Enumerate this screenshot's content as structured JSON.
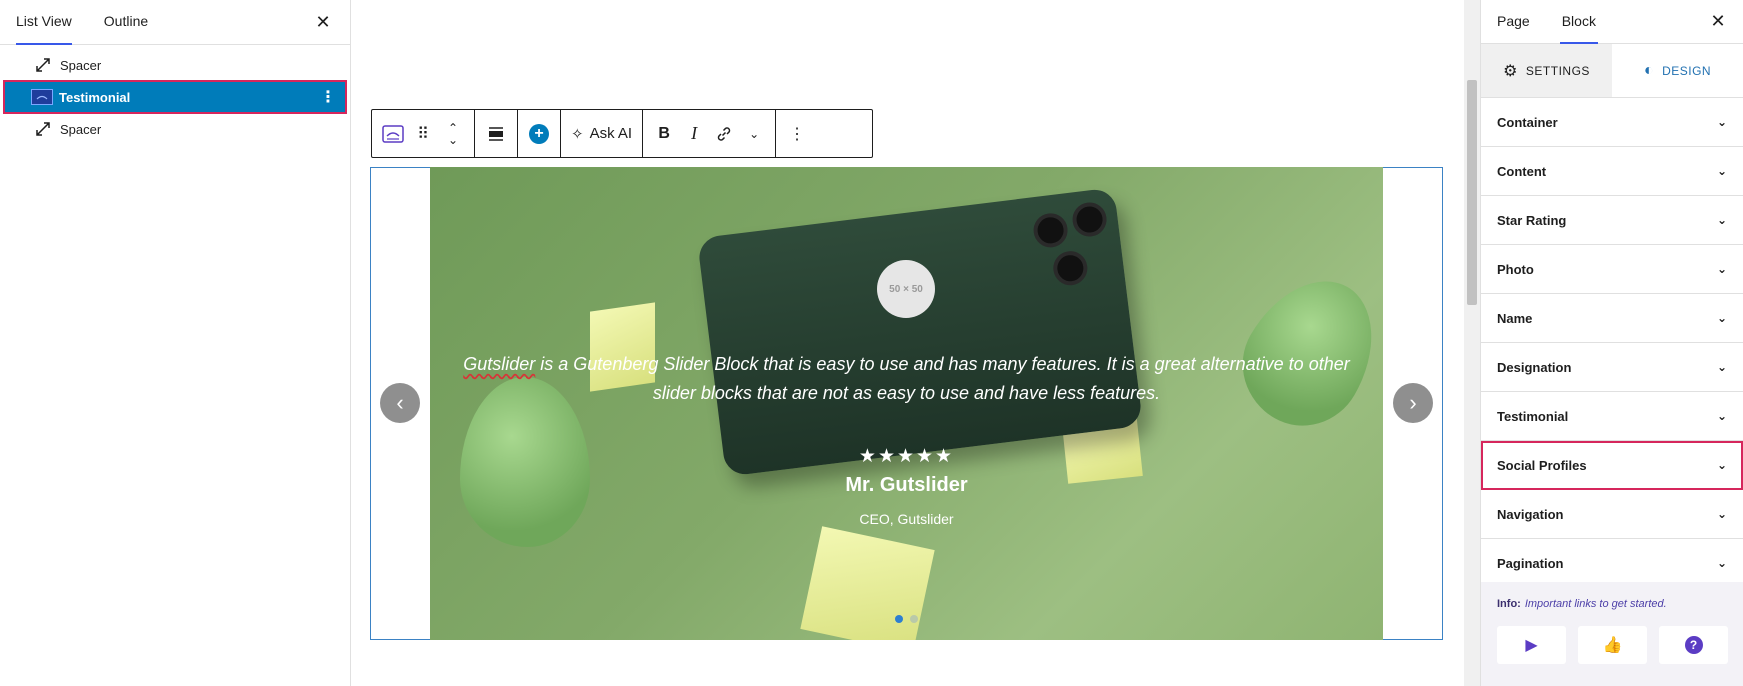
{
  "list_view": {
    "tabs": [
      "List View",
      "Outline"
    ],
    "items": [
      {
        "label": "Spacer",
        "icon": "resize-arrows-icon"
      },
      {
        "label": "Testimonial",
        "icon": "slider-block-icon",
        "selected": true
      },
      {
        "label": "Spacer",
        "icon": "resize-arrows-icon"
      }
    ]
  },
  "toolbar": {
    "ask_ai_label": "Ask AI"
  },
  "slide": {
    "avatar_placeholder": "50 × 50",
    "quote_first_word": "Gutslider",
    "quote_rest": " is a Gutenberg Slider Block that is easy to use and has many features. It is a great alternative to other slider blocks that are not as easy to use and have less features.",
    "stars": "★★★★★",
    "rating": 5,
    "name": "Mr. Gutslider",
    "designation": "CEO, Gutslider",
    "pagination_count": 2,
    "active_slide": 1
  },
  "sidebar": {
    "tabs": [
      "Page",
      "Block"
    ],
    "modes": [
      "SETTINGS",
      "DESIGN"
    ],
    "panels": [
      "Container",
      "Content",
      "Star Rating",
      "Photo",
      "Name",
      "Designation",
      "Testimonial",
      "Social Profiles",
      "Navigation",
      "Pagination"
    ],
    "highlighted_panel": "Social Profiles",
    "info_label": "Info:",
    "info_text": "Important links to get started."
  },
  "colors": {
    "accent": "#007cba",
    "highlight": "#d6265c",
    "design_tab": "#2271b1"
  }
}
